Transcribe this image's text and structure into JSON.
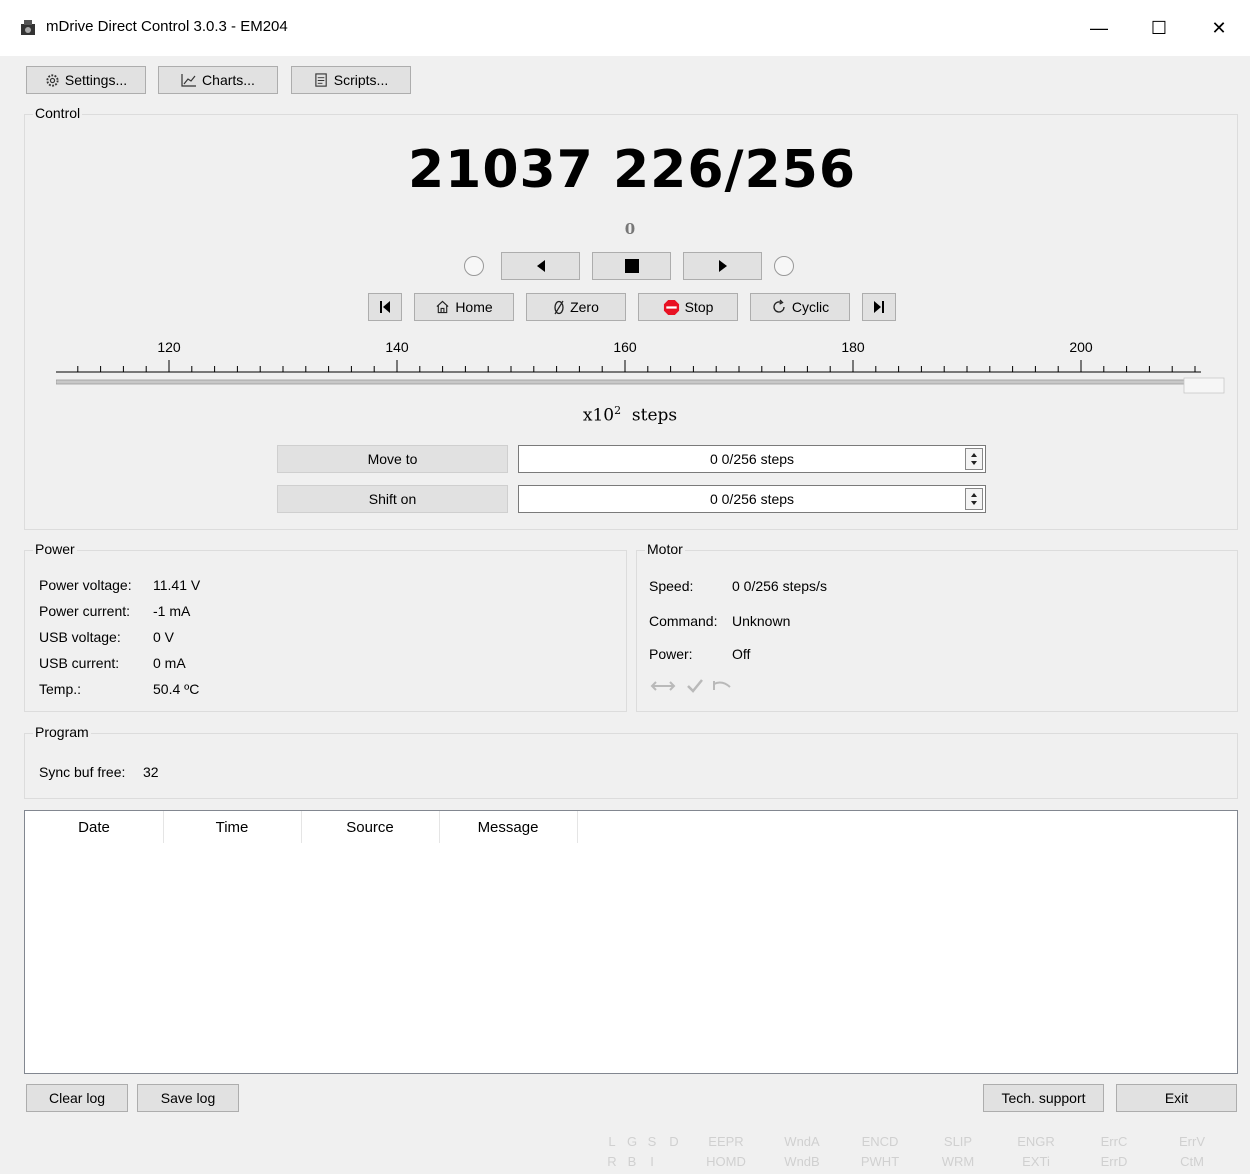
{
  "window": {
    "title": "mDrive Direct Control 3.0.3 - EM204",
    "minimize": "—",
    "maximize": "☐",
    "close": "✕"
  },
  "toolbar": {
    "settings": "Settings...",
    "charts": "Charts...",
    "scripts": "Scripts..."
  },
  "control": {
    "group_title": "Control",
    "position": "21037 226/256",
    "encoder": "0",
    "home": "Home",
    "zero": "Zero",
    "stop": "Stop",
    "cyclic": "Cyclic",
    "ruler_labels": [
      "120",
      "140",
      "160",
      "180",
      "200"
    ],
    "units": "x10",
    "units_exp": "2",
    "units_suffix": "steps",
    "move_to_label": "Move to",
    "move_to_value": "0 0/256 steps",
    "shift_on_label": "Shift on",
    "shift_on_value": "0 0/256 steps"
  },
  "power": {
    "group_title": "Power",
    "rows": [
      {
        "label": "Power voltage:",
        "value": "11.41 V"
      },
      {
        "label": "Power current:",
        "value": "-1 mA"
      },
      {
        "label": "USB voltage:",
        "value": "0 V"
      },
      {
        "label": "USB current:",
        "value": "0 mA"
      },
      {
        "label": "Temp.:",
        "value": "50.4 ºC"
      }
    ]
  },
  "motor": {
    "group_title": "Motor",
    "rows": [
      {
        "label": "Speed:",
        "value": "0 0/256 steps/s"
      },
      {
        "label": "Command:",
        "value": "Unknown"
      },
      {
        "label": "Power:",
        "value": "Off"
      }
    ]
  },
  "program": {
    "group_title": "Program",
    "sync_label": "Sync buf free:",
    "sync_value": "32"
  },
  "log": {
    "columns": [
      "Date",
      "Time",
      "Source",
      "Message"
    ]
  },
  "bottom": {
    "clear_log": "Clear log",
    "save_log": "Save log",
    "tech_support": "Tech. support",
    "exit": "Exit"
  },
  "flags": {
    "top": [
      "L",
      "G",
      "S",
      "D",
      "EEPR",
      "WndA",
      "ENCD",
      "SLIP",
      "ENGR",
      "ErrC",
      "ErrV"
    ],
    "bottom": [
      "R",
      "B",
      "I",
      "",
      "HOMD",
      "WndB",
      "PWHT",
      "WRM",
      "EXTi",
      "ErrD",
      "CtM"
    ]
  },
  "colors": {
    "accent_stop": "#e81123"
  }
}
